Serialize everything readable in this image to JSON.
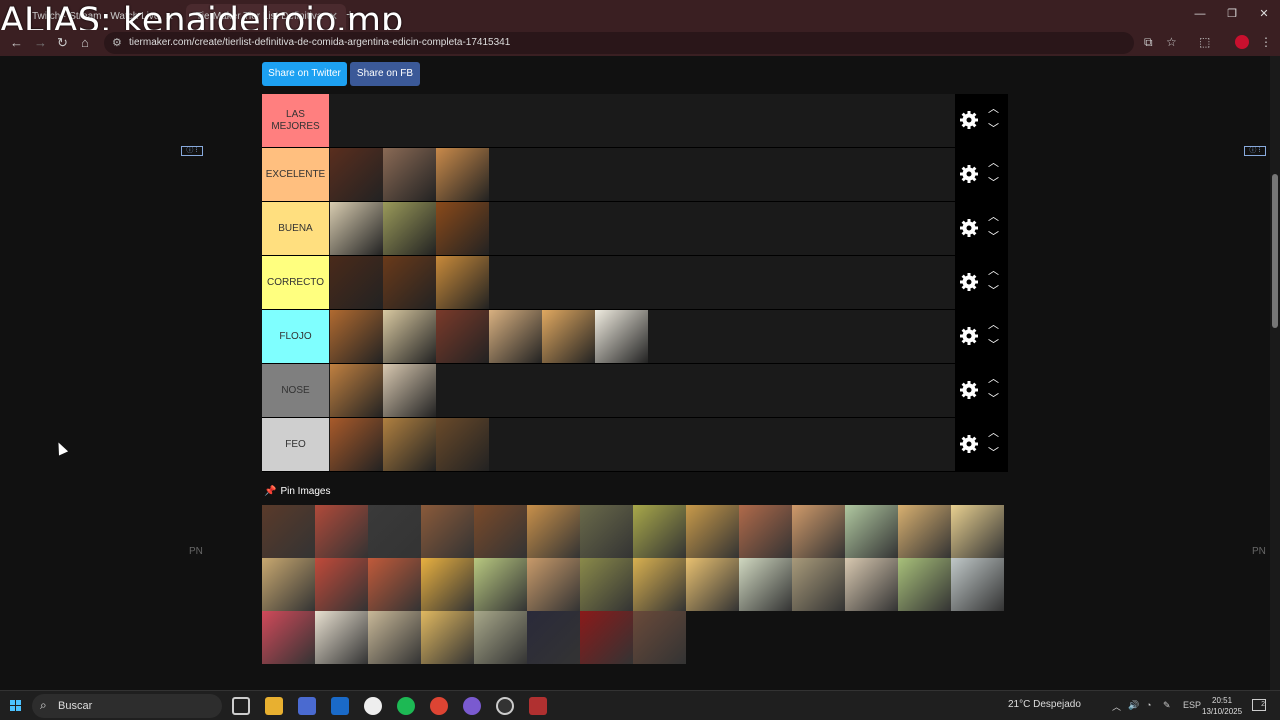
{
  "overlay": {
    "alias_text": "ALIAS: kenaidelrojo.mp"
  },
  "browser": {
    "tabs": [
      {
        "label": "Twitch · Stream · Watch Live"
      },
      {
        "label": "TierMaker Tier List Definitiva"
      }
    ],
    "url": "tiermaker.com/create/tierlist-definitiva-de-comida-argentina-edicin-completa-17415341",
    "nav_icons": [
      "back-icon",
      "forward-icon",
      "reload-icon",
      "home-icon"
    ]
  },
  "page": {
    "share_twitter": "Share on Twitter",
    "share_fb": "Share on FB",
    "ad_label": "ⓘ ⁝",
    "pn_left": "PN",
    "pn_right": "PN",
    "pin_images_title": "Pin Images"
  },
  "tiers": [
    {
      "label": "LAS MEJORES",
      "color": "#ff7f7f",
      "items": []
    },
    {
      "label": "EXCELENTE",
      "color": "#ffbf7f",
      "items": [
        "#5a2e1e",
        "#8a6a55",
        "#c98a4a"
      ]
    },
    {
      "label": "BUENA",
      "color": "#ffdf7f",
      "items": [
        "#d8ccb0",
        "#9a9a5a",
        "#8a4a1a"
      ]
    },
    {
      "label": "CORRECTO",
      "color": "#ffff7f",
      "items": [
        "#4a2a1a",
        "#6a3a1a",
        "#c88a3a"
      ]
    },
    {
      "label": "FLOJO",
      "color": "#7fffff",
      "items": [
        "#b06a30",
        "#d8c8a0",
        "#7a3a2a",
        "#d8b080",
        "#e0a860",
        "#f0ece0"
      ]
    },
    {
      "label": "NOSE",
      "color": "#7f7f7f",
      "items": [
        "#c08040",
        "#d8c8b0"
      ]
    },
    {
      "label": "FEO",
      "color": "#cfcfcf",
      "items": [
        "#a85a2a",
        "#b08040",
        "#6a4a2a"
      ]
    }
  ],
  "pool": [
    "#5a3a2a",
    "#b04a3a",
    "#3a3a3a",
    "#8a5a3a",
    "#7a4a2a",
    "#c8904a",
    "#6a6a4a",
    "#a8a84a",
    "#c89a4a",
    "#b06a4a",
    "#d09a6a",
    "#b0c8a0",
    "#d8b070",
    "#e8d090",
    "#c8a870",
    "#c04a3a",
    "#c05a3a",
    "#e8b040",
    "#b8c880",
    "#c89a6a",
    "#8a8a4a",
    "#d8b050",
    "#e8c070",
    "#d0d8c0",
    "#a89a7a",
    "#d8c8b0",
    "#a8c07a",
    "#c0c8c8",
    "#d04a5a",
    "#e8e0d0",
    "#c8b898",
    "#e0b860",
    "#a8a88a",
    "#2a2a3a",
    "#8a1a1a",
    "#6a4a3a"
  ],
  "taskbar": {
    "search_label": "Buscar",
    "weather": "21°C  Despejado",
    "lang": "ESP",
    "time": "20:51",
    "date": "13/10/2025",
    "notifications": "2"
  }
}
